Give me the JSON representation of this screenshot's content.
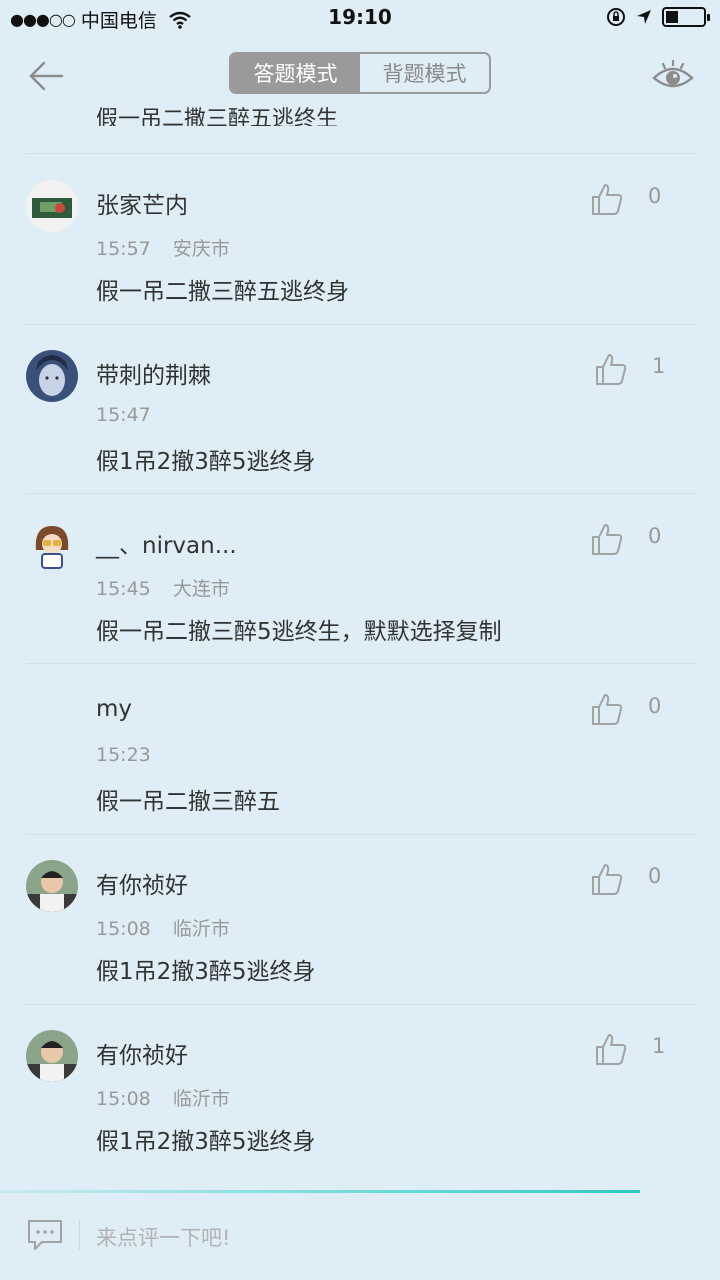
{
  "status_bar": {
    "signal": "●●●○○",
    "carrier": "中国电信",
    "time": "19:10"
  },
  "nav": {
    "tabs": [
      {
        "label": "答题模式",
        "active": true
      },
      {
        "label": "背题模式",
        "active": false
      }
    ]
  },
  "cut_off_comment": "假一吊二撒三醉五逃终生",
  "comments": [
    {
      "username": "张家芒内",
      "time": "15:57",
      "location": "安庆市",
      "content": "假一吊二撒三醉五逃终身",
      "likes": "0",
      "avatar": "avatar-car"
    },
    {
      "username": "带刺的荆棘",
      "time": "15:47",
      "location": "",
      "content": "假1吊2撤3醉5逃终身",
      "likes": "1",
      "avatar": "avatar-face"
    },
    {
      "username": "__、nirvan...",
      "time": "15:45",
      "location": "大连市",
      "content": "假一吊二撤三醉5逃终生，默默选择复制",
      "likes": "0",
      "avatar": "avatar-cartoon"
    },
    {
      "username": "my",
      "time": "15:23",
      "location": "",
      "content": "假一吊二撤三醉五",
      "likes": "0",
      "avatar": "none"
    },
    {
      "username": "有你祯好",
      "time": "15:08",
      "location": "临沂市",
      "content": "假1吊2撤3醉5逃终身",
      "likes": "0",
      "avatar": "avatar-boy"
    },
    {
      "username": "有你祯好",
      "time": "15:08",
      "location": "临沂市",
      "content": "假1吊2撤3醉5逃终身",
      "likes": "1",
      "avatar": "avatar-boy"
    }
  ],
  "bottom": {
    "placeholder": "来点评一下吧!"
  },
  "colors": {
    "background": "#dfeef6",
    "accent_line": "#4fd6d0"
  }
}
